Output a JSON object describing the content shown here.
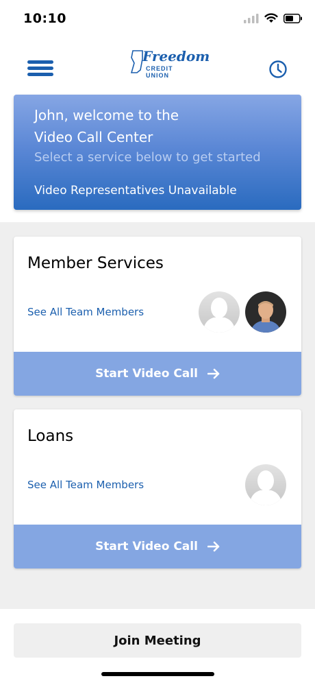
{
  "status_bar": {
    "time": "10:10"
  },
  "header": {
    "menu_icon": "hamburger-menu-icon",
    "logo": {
      "main": "Freedom",
      "sub": "CREDIT UNION"
    },
    "history_icon": "clock-icon"
  },
  "hero": {
    "title_line1": "John, welcome to the",
    "title_line2": "Video Call Center",
    "subtitle": "Select a service below to get started",
    "status": "Video Representatives Unavailable"
  },
  "services": [
    {
      "title": "Member Services",
      "link": "See All Team Members",
      "cta": "Start Video Call",
      "avatars": [
        "placeholder-avatar",
        "photo-avatar"
      ]
    },
    {
      "title": "Loans",
      "link": "See All Team Members",
      "cta": "Start Video Call",
      "avatars": [
        "placeholder-avatar"
      ]
    }
  ],
  "footer": {
    "join_label": "Join Meeting"
  },
  "colors": {
    "brand_blue": "#1b5fae",
    "hero_top": "#86a6e4",
    "hero_bottom": "#2a6bbf",
    "cta_blue": "#84a6e2",
    "background_gray": "#efefef"
  }
}
